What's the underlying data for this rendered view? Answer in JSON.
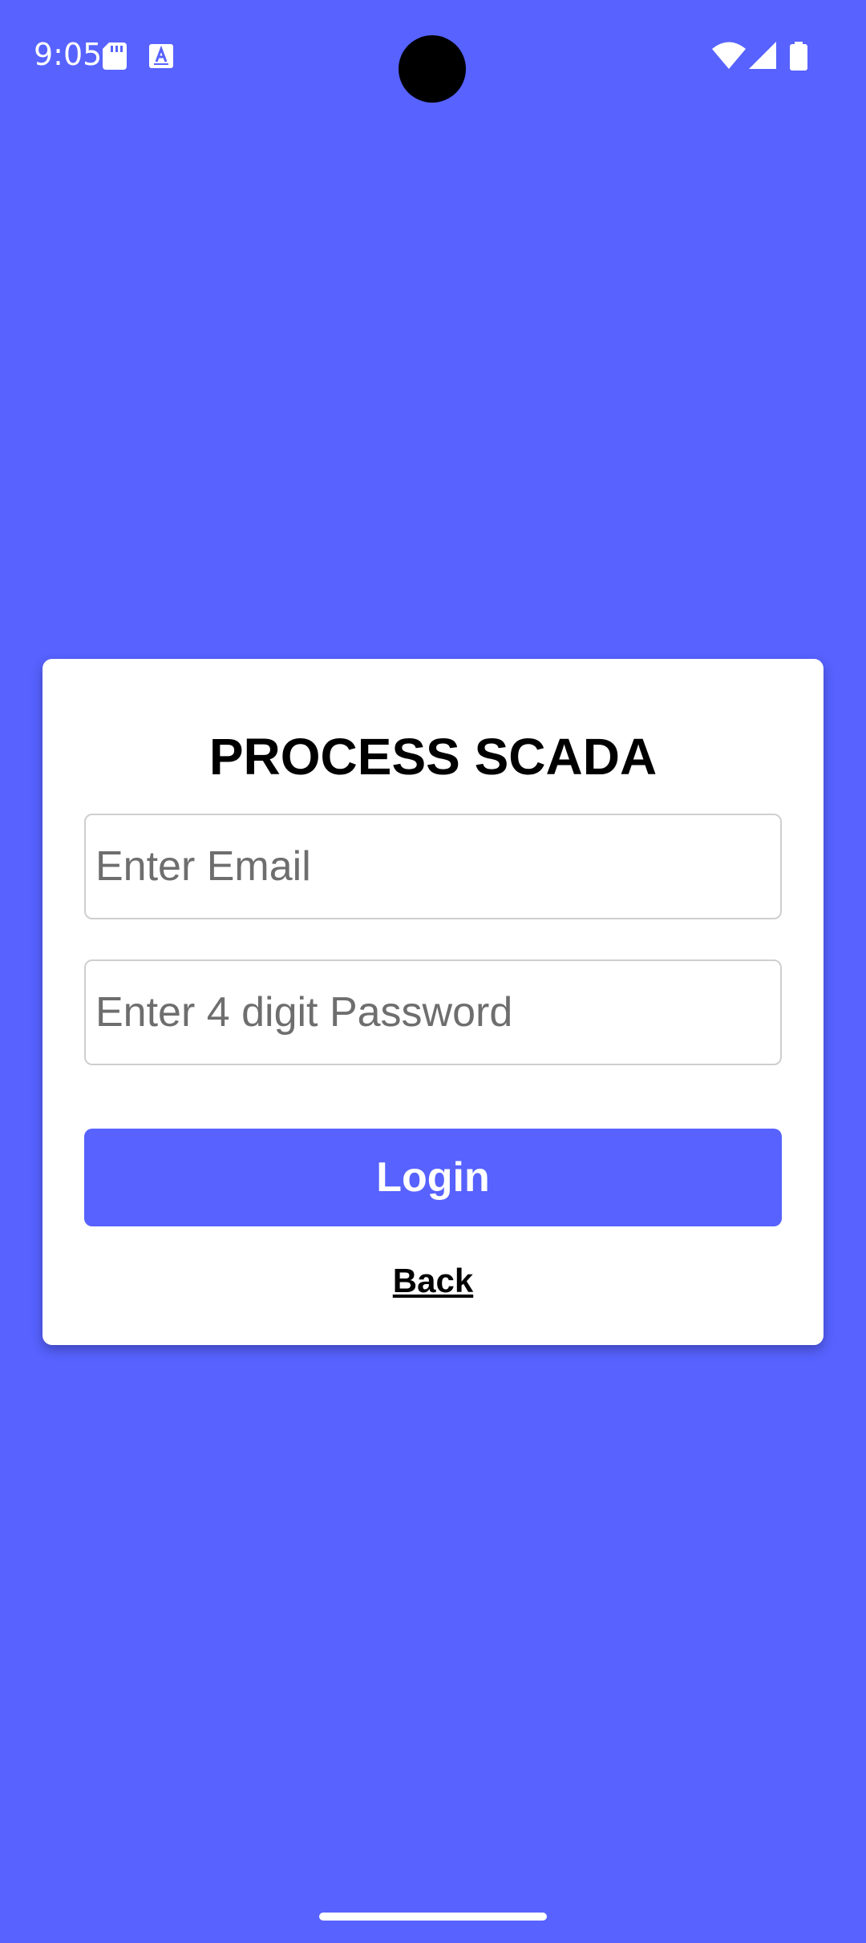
{
  "status_bar": {
    "time": "9:05",
    "icons": [
      "sd-card-icon",
      "text-a-icon",
      "wifi-icon",
      "cellular-signal-icon",
      "battery-icon"
    ]
  },
  "colors": {
    "background": "#5762FF",
    "accent": "#5762FF",
    "card": "#FFFFFF",
    "text": "#000000"
  },
  "login_card": {
    "title": "PROCESS SCADA",
    "email": {
      "placeholder": "Enter Email",
      "value": ""
    },
    "password": {
      "placeholder": "Enter 4 digit Password",
      "value": ""
    },
    "login_label": "Login",
    "back_label": "Back"
  }
}
